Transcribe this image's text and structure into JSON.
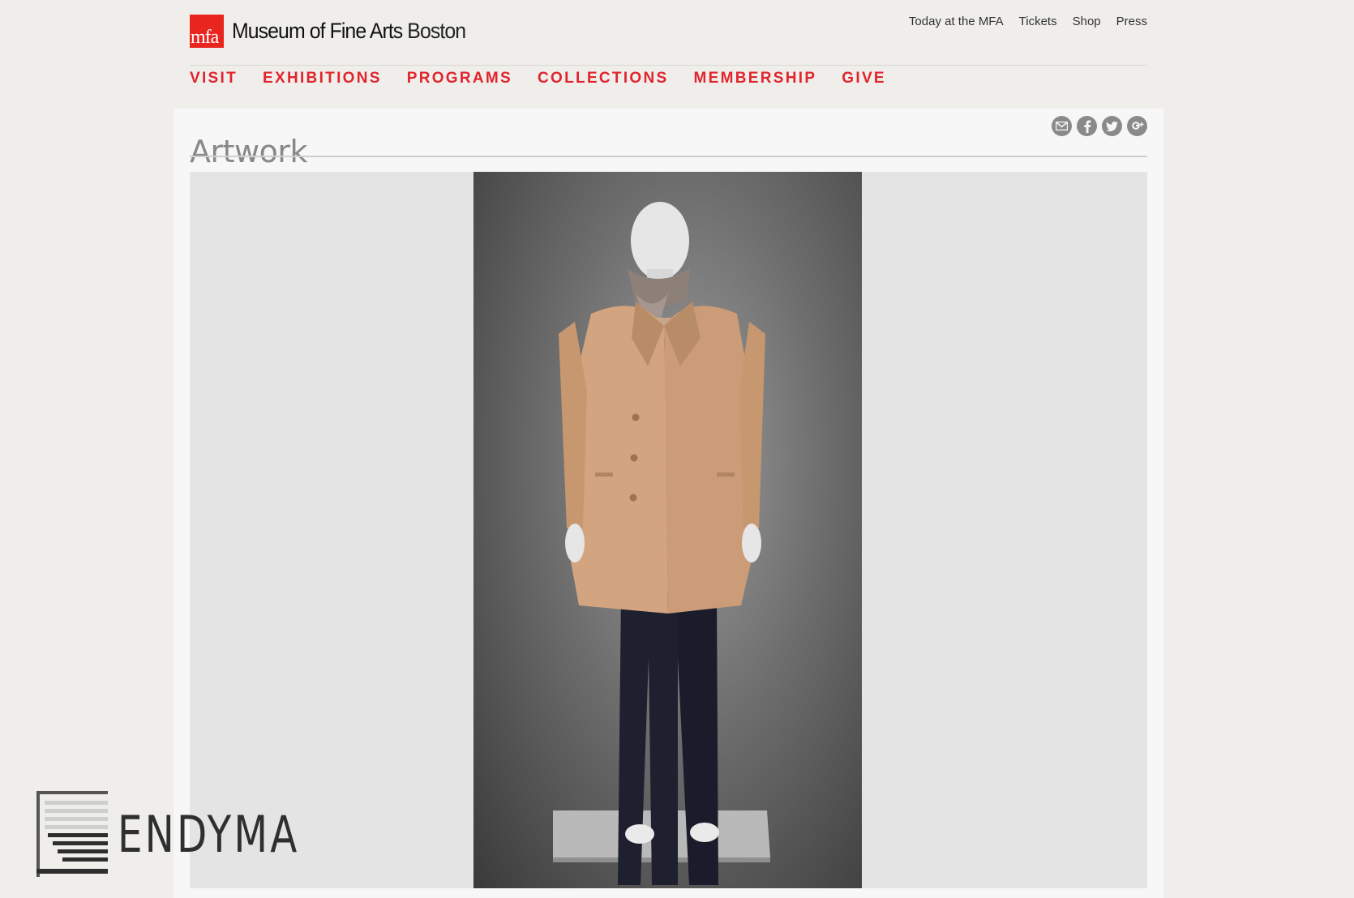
{
  "header": {
    "logo_mark": "mfa",
    "logo_text": "Museum of Fine Arts",
    "logo_city": "Boston",
    "utility_links": [
      "Today at the MFA",
      "Tickets",
      "Shop",
      "Press"
    ],
    "nav": [
      "VISIT",
      "EXHIBITIONS",
      "PROGRAMS",
      "COLLECTIONS",
      "MEMBERSHIP",
      "GIVE"
    ],
    "accent_color": "#e1242d"
  },
  "main": {
    "title": "Artwork",
    "share_icons": [
      "email-icon",
      "facebook-icon",
      "twitter-icon",
      "google-plus-icon"
    ]
  },
  "watermark": {
    "text": "ENDYMA"
  }
}
